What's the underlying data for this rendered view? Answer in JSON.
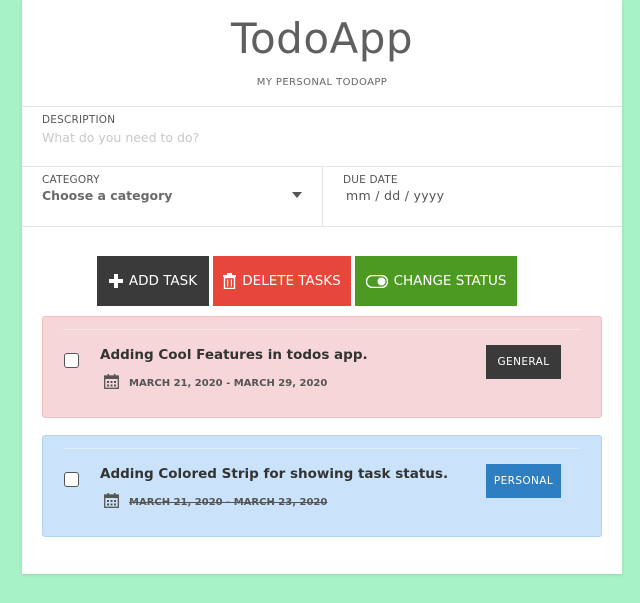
{
  "app": {
    "title": "TodoApp",
    "subtitle": "MY PERSONAL TODOAPP"
  },
  "form": {
    "description_label": "DESCRIPTION",
    "description_placeholder": "What do you need to do?",
    "description_value": "",
    "category_label": "CATEGORY",
    "category_selected": "Choose a category",
    "due_date_label": "DUE DATE",
    "due_date_placeholder": "mm / dd / yyyy"
  },
  "toolbar": {
    "add_label": "ADD TASK",
    "delete_label": "DELETE TASKS",
    "status_label": "CHANGE STATUS"
  },
  "tasks": [
    {
      "title": "Adding Cool Features in todos app.",
      "date_range": "MARCH 21, 2020 - MARCH 29, 2020",
      "category": "GENERAL",
      "checked": false,
      "background": "#f6d6d8",
      "badge_color": "#3a3a3a",
      "date_struck": false
    },
    {
      "title": "Adding Colored Strip for showing task status.",
      "date_range": "MARCH 21, 2020 - MARCH 23, 2020",
      "category": "PERSONAL",
      "checked": false,
      "background": "#cbe3fa",
      "badge_color": "#2d7fc1",
      "date_struck": true
    }
  ],
  "colors": {
    "page_background": "#a8f2c8",
    "add_button": "#3a3a3a",
    "delete_button": "#e6473a",
    "status_button": "#4c9a22"
  },
  "icons": {
    "add": "plus-icon",
    "delete": "trash-icon",
    "status": "toggle-icon",
    "date": "calendar-icon",
    "select": "caret-down-icon"
  }
}
